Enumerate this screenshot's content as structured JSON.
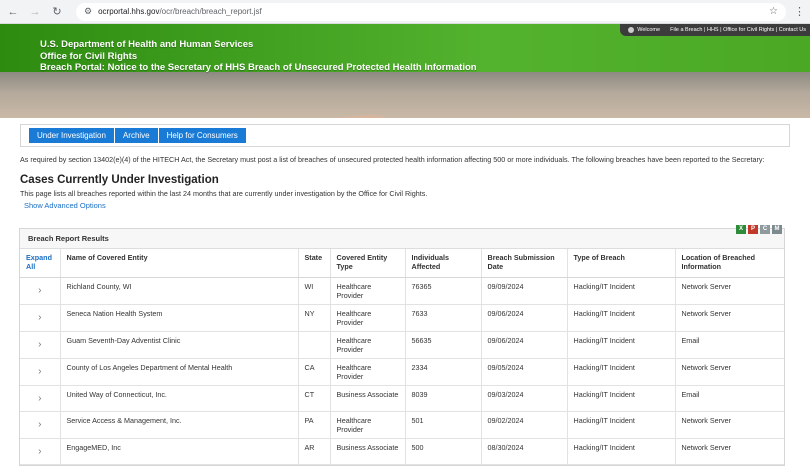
{
  "browser": {
    "url_host": "ocrportal.hhs.gov",
    "url_path": "/ocr/breach/breach_report.jsf"
  },
  "topnav": {
    "welcome": "Welcome",
    "links": "File a Breach | HHS | Office for Civil Rights | Contact Us"
  },
  "banner": {
    "line1": "U.S. Department of Health and Human Services",
    "line2": "Office for Civil Rights",
    "line3": "Breach Portal: Notice to the Secretary of HHS Breach of Unsecured Protected Health Information"
  },
  "tabs": [
    "Under Investigation",
    "Archive",
    "Help for Consumers"
  ],
  "intro": "As required by section 13402(e)(4) of the HITECH Act, the Secretary must post a list of breaches of unsecured protected health information affecting 500 or more individuals. The following breaches have been reported to the Secretary:",
  "heading": "Cases Currently Under Investigation",
  "subheading": "This page lists all breaches reported within the last 24 months that are currently under investigation by the Office for Civil Rights.",
  "advanced_link": "Show Advanced Options",
  "results_title": "Breach Report Results",
  "columns": {
    "expand": "Expand All",
    "name": "Name of Covered Entity",
    "state": "State",
    "type": "Covered Entity Type",
    "affected": "Individuals Affected",
    "date": "Breach Submission Date",
    "breach": "Type of Breach",
    "location": "Location of Breached Information"
  },
  "rows": [
    {
      "name": "Richland County, WI",
      "state": "WI",
      "type": "Healthcare Provider",
      "affected": "76365",
      "date": "09/09/2024",
      "breach": "Hacking/IT Incident",
      "location": "Network Server"
    },
    {
      "name": "Seneca Nation Health System",
      "state": "NY",
      "type": "Healthcare Provider",
      "affected": "7633",
      "date": "09/06/2024",
      "breach": "Hacking/IT Incident",
      "location": "Network Server"
    },
    {
      "name": "Guam Seventh-Day Adventist Clinic",
      "state": "",
      "type": "Healthcare Provider",
      "affected": "56635",
      "date": "09/06/2024",
      "breach": "Hacking/IT Incident",
      "location": "Email"
    },
    {
      "name": "County of Los Angeles Department of Mental Health",
      "state": "CA",
      "type": "Healthcare Provider",
      "affected": "2334",
      "date": "09/05/2024",
      "breach": "Hacking/IT Incident",
      "location": "Network Server"
    },
    {
      "name": "United Way of Connecticut, Inc.",
      "state": "CT",
      "type": "Business Associate",
      "affected": "8039",
      "date": "09/03/2024",
      "breach": "Hacking/IT Incident",
      "location": "Email"
    },
    {
      "name": "Service Access & Management, Inc.",
      "state": "PA",
      "type": "Healthcare Provider",
      "affected": "501",
      "date": "09/02/2024",
      "breach": "Hacking/IT Incident",
      "location": "Network Server"
    },
    {
      "name": "EngageMED, Inc",
      "state": "AR",
      "type": "Business Associate",
      "affected": "500",
      "date": "08/30/2024",
      "breach": "Hacking/IT Incident",
      "location": "Network Server"
    }
  ]
}
